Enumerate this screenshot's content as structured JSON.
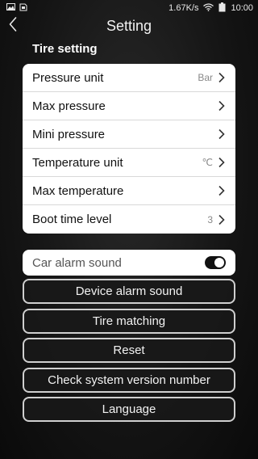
{
  "status_bar": {
    "speed": "1.67K/s",
    "time": "10:00",
    "left_icons": [
      "image-icon",
      "sim-icon"
    ],
    "right_icons": [
      "wifi-icon",
      "battery-icon"
    ]
  },
  "nav": {
    "title": "Setting",
    "back_icon": "back-icon"
  },
  "tire_setting": {
    "title": "Tire setting",
    "rows": [
      {
        "label": "Pressure unit",
        "value": "Bar"
      },
      {
        "label": "Max pressure",
        "value": ""
      },
      {
        "label": "Mini pressure",
        "value": ""
      },
      {
        "label": "Temperature unit",
        "value": "℃"
      },
      {
        "label": "Max temperature",
        "value": ""
      },
      {
        "label": "Boot time level",
        "value": "3"
      }
    ]
  },
  "car_alarm": {
    "label": "Car alarm sound",
    "enabled": true
  },
  "buttons": {
    "device_alarm": "Device alarm sound",
    "tire_matching": "Tire matching",
    "reset": "Reset",
    "check_version": "Check system version number",
    "language": "Language"
  },
  "colors": {
    "card_bg": "#ffffff",
    "toggle_on": "#111111",
    "button_border": "#cfcfcf"
  }
}
